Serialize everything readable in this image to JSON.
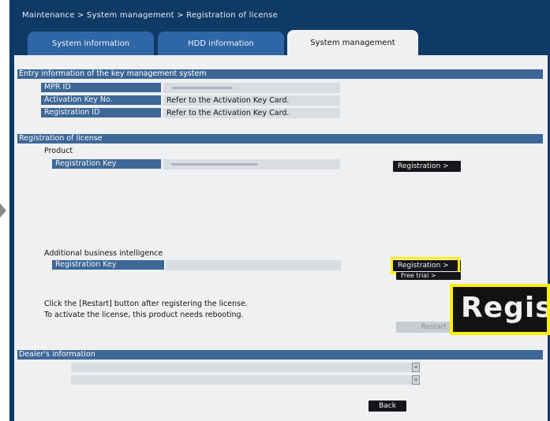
{
  "breadcrumb": "Maintenance > System management > Registration of license",
  "tabs": [
    {
      "label": "System information"
    },
    {
      "label": "HDD information"
    },
    {
      "label": "System management"
    }
  ],
  "key_mgmt": {
    "header": "Entry information of the key management system",
    "mpr_id_label": "MPR ID",
    "activation_label": "Activation Key No.",
    "activation_value": "Refer to the Activation Key Card.",
    "registration_id_label": "Registration ID",
    "registration_id_value": "Refer to the Activation Key Card."
  },
  "license": {
    "header": "Registration of license",
    "product_title": "Product",
    "product_key_label": "Registration Key",
    "product_register_button": "Registration >",
    "abi_title": "Additional business intelligence",
    "abi_key_label": "Registration Key",
    "abi_register_button": "Registration >",
    "free_trial_button": "Free trial >",
    "note_line1": "Click the [Restart] button after registering the license.",
    "note_line2": "To activate the license, this product needs rebooting.",
    "restart_button": "Restart"
  },
  "dealer": {
    "header": "Dealer's information"
  },
  "back_button": "Back",
  "zoom_callout": "Regis",
  "colors": {
    "frame": "#0f3a66",
    "band": "#3e6797",
    "highlight": "#ffef00",
    "panel": "#eef0f2"
  }
}
